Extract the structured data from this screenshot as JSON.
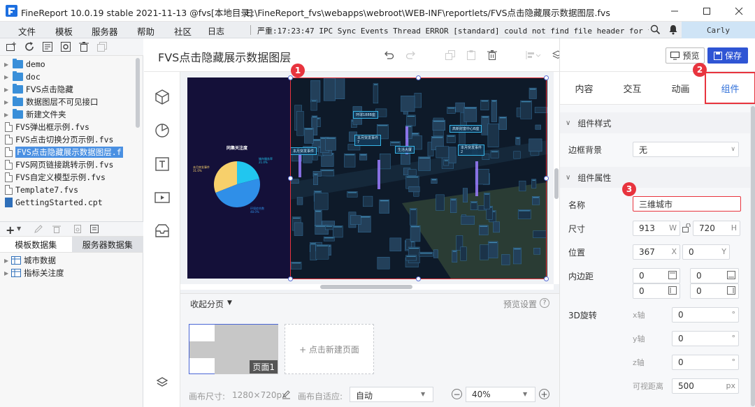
{
  "window": {
    "title": "FineReport 10.0.19 stable 2021-11-13 @fvs[本地目录]",
    "path": "E:\\FineReport_fvs\\webapps\\webroot\\WEB-INF\\reportlets/FVS点击隐藏展示数据图层.fvs"
  },
  "menu": [
    "文件",
    "模板",
    "服务器",
    "帮助",
    "社区"
  ],
  "log": {
    "label": "日志",
    "text": "严重:17:23:47 IPC Sync Events Thread ERROR [standard] could not find file header for file:..."
  },
  "user": "Carly",
  "file_tree": [
    {
      "type": "folder",
      "label": "demo"
    },
    {
      "type": "folder",
      "label": "doc"
    },
    {
      "type": "folder",
      "label": "FVS点击隐藏"
    },
    {
      "type": "folder",
      "label": "数据图层不可见接口"
    },
    {
      "type": "folder",
      "label": "新建文件夹"
    },
    {
      "type": "file",
      "label": "FVS弹出框示例.fvs"
    },
    {
      "type": "file",
      "label": "FVS点击切换分页示例.fvs"
    },
    {
      "type": "file",
      "label": "FVS点击隐藏展示数据图层.f",
      "selected": true
    },
    {
      "type": "file",
      "label": "FVS网页链接跳转示例.fvs"
    },
    {
      "type": "file",
      "label": "FVS自定义模型示例.fvs"
    },
    {
      "type": "file",
      "label": "Template7.fvs"
    },
    {
      "type": "fileb",
      "label": "GettingStarted.cpt"
    }
  ],
  "dataset_tabs": [
    "模板数据集",
    "服务器数据集"
  ],
  "datasets": [
    "城市数据",
    "指标关注度"
  ],
  "editor": {
    "title": "FVS点击隐藏展示数据图层",
    "preview": "预览",
    "save": "保存",
    "fold_pages": "收起分页",
    "preview_settings": "预览设置",
    "page_label": "页面1",
    "new_page": "+ 点击新建页面",
    "canvas_size_label": "画布尺寸:",
    "canvas_size": "1280×720px",
    "adapt_label": "画布自适应:",
    "adapt_value": "自动",
    "zoom": "40%"
  },
  "canvas": {
    "chart_title": "同集关注度",
    "pie_labels": [
      "本月突发事件\n31.0%",
      "城市服务率\n21.0%",
      "环境综合数\n48.0%"
    ],
    "scene_labels": [
      "环球188B座",
      "高新财富中心B座",
      "本月突发事件\n7",
      "本月突发事件\n2",
      "本月突发事件",
      "生活大厦"
    ]
  },
  "chart_data": {
    "type": "pie",
    "categories": [
      "本月突发事件",
      "城市服务率",
      "环境综合数"
    ],
    "values": [
      31.0,
      21.0,
      48.0
    ],
    "title": "同集关注度",
    "colors": [
      "#f7d06b",
      "#21c6ef",
      "#2f8fe8"
    ]
  },
  "right_tabs": [
    "内容",
    "交互",
    "动画",
    "组件"
  ],
  "properties": {
    "section_style": "组件样式",
    "border_bg_label": "边框背景",
    "border_bg_value": "无",
    "section_attr": "组件属性",
    "name_label": "名称",
    "name_value": "三维城市",
    "size_label": "尺寸",
    "size_w": "913",
    "size_h": "720",
    "pos_label": "位置",
    "pos_x": "367",
    "pos_y": "0",
    "padding_label": "内边距",
    "padding": [
      "0",
      "0",
      "0",
      "0"
    ],
    "rotate_label": "3D旋转",
    "axis_x": "x轴",
    "axis_y": "y轴",
    "axis_z": "z轴",
    "rot_x": "0",
    "rot_y": "0",
    "rot_z": "0",
    "view_dist_label": "可视距离",
    "view_dist": "500",
    "unit_w": "W",
    "unit_h": "H",
    "unit_x": "X",
    "unit_y": "Y",
    "unit_deg": "°",
    "unit_px": "px"
  },
  "markers": [
    "1",
    "2",
    "3"
  ]
}
